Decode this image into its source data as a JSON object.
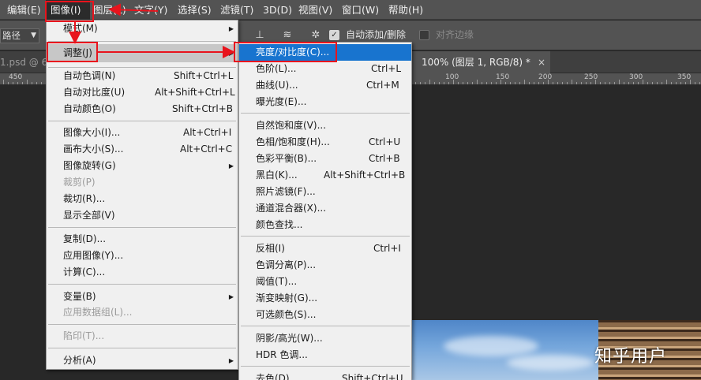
{
  "menubar": {
    "items": [
      {
        "label": "编辑(E)"
      },
      {
        "label": "图像(I)"
      },
      {
        "label": "图层(L)"
      },
      {
        "label": "文字(Y)"
      },
      {
        "label": "选择(S)"
      },
      {
        "label": "滤镜(T)"
      },
      {
        "label": "3D(D)"
      },
      {
        "label": "视图(V)"
      },
      {
        "label": "窗口(W)"
      },
      {
        "label": "帮助(H)"
      }
    ]
  },
  "options": {
    "path_mode": "路径",
    "auto_add_delete_label": "自动添加/删除",
    "auto_add_delete_checked": true,
    "align_edges_label": "对齐边缘",
    "align_edges_checked": false
  },
  "tabs": {
    "left_fragment": "1.psd @ 6",
    "active_fragment": "100% (图层 1, RGB/8) *",
    "close_glyph": "×"
  },
  "ruler": {
    "labels": [
      "450",
      "100",
      "150",
      "200",
      "250",
      "300",
      "350"
    ]
  },
  "watermark": "知乎用户",
  "image_menu": {
    "items": [
      {
        "label": "模式(M)",
        "submenu": true
      },
      {
        "label": "调整(J)",
        "submenu": true,
        "highlighted": true
      },
      {
        "label": "自动色调(N)",
        "shortcut": "Shift+Ctrl+L"
      },
      {
        "label": "自动对比度(U)",
        "shortcut": "Alt+Shift+Ctrl+L"
      },
      {
        "label": "自动颜色(O)",
        "shortcut": "Shift+Ctrl+B"
      },
      {
        "label": "图像大小(I)...",
        "shortcut": "Alt+Ctrl+I"
      },
      {
        "label": "画布大小(S)...",
        "shortcut": "Alt+Ctrl+C"
      },
      {
        "label": "图像旋转(G)",
        "submenu": true
      },
      {
        "label": "裁剪(P)",
        "disabled": true
      },
      {
        "label": "裁切(R)..."
      },
      {
        "label": "显示全部(V)"
      },
      {
        "label": "复制(D)..."
      },
      {
        "label": "应用图像(Y)..."
      },
      {
        "label": "计算(C)..."
      },
      {
        "label": "变量(B)",
        "submenu": true
      },
      {
        "label": "应用数据组(L)...",
        "disabled": true
      },
      {
        "label": "陷印(T)...",
        "disabled": true
      },
      {
        "label": "分析(A)",
        "submenu": true
      }
    ]
  },
  "adjust_menu": {
    "items": [
      {
        "label": "亮度/对比度(C)...",
        "highlighted": true
      },
      {
        "label": "色阶(L)...",
        "shortcut": "Ctrl+L"
      },
      {
        "label": "曲线(U)...",
        "shortcut": "Ctrl+M"
      },
      {
        "label": "曝光度(E)..."
      },
      {
        "label": "自然饱和度(V)..."
      },
      {
        "label": "色相/饱和度(H)...",
        "shortcut": "Ctrl+U"
      },
      {
        "label": "色彩平衡(B)...",
        "shortcut": "Ctrl+B"
      },
      {
        "label": "黑白(K)...",
        "shortcut": "Alt+Shift+Ctrl+B"
      },
      {
        "label": "照片滤镜(F)..."
      },
      {
        "label": "通道混合器(X)..."
      },
      {
        "label": "颜色查找..."
      },
      {
        "label": "反相(I)",
        "shortcut": "Ctrl+I"
      },
      {
        "label": "色调分离(P)..."
      },
      {
        "label": "阈值(T)..."
      },
      {
        "label": "渐变映射(G)..."
      },
      {
        "label": "可选颜色(S)..."
      },
      {
        "label": "阴影/高光(W)..."
      },
      {
        "label": "HDR 色调..."
      },
      {
        "label": "去色(D)",
        "shortcut": "Shift+Ctrl+U"
      }
    ]
  },
  "colors": {
    "highlight": "#1874cf",
    "annotation": "#e8141d",
    "menubar": "#535353",
    "menu_bg": "#f0f0f0"
  }
}
